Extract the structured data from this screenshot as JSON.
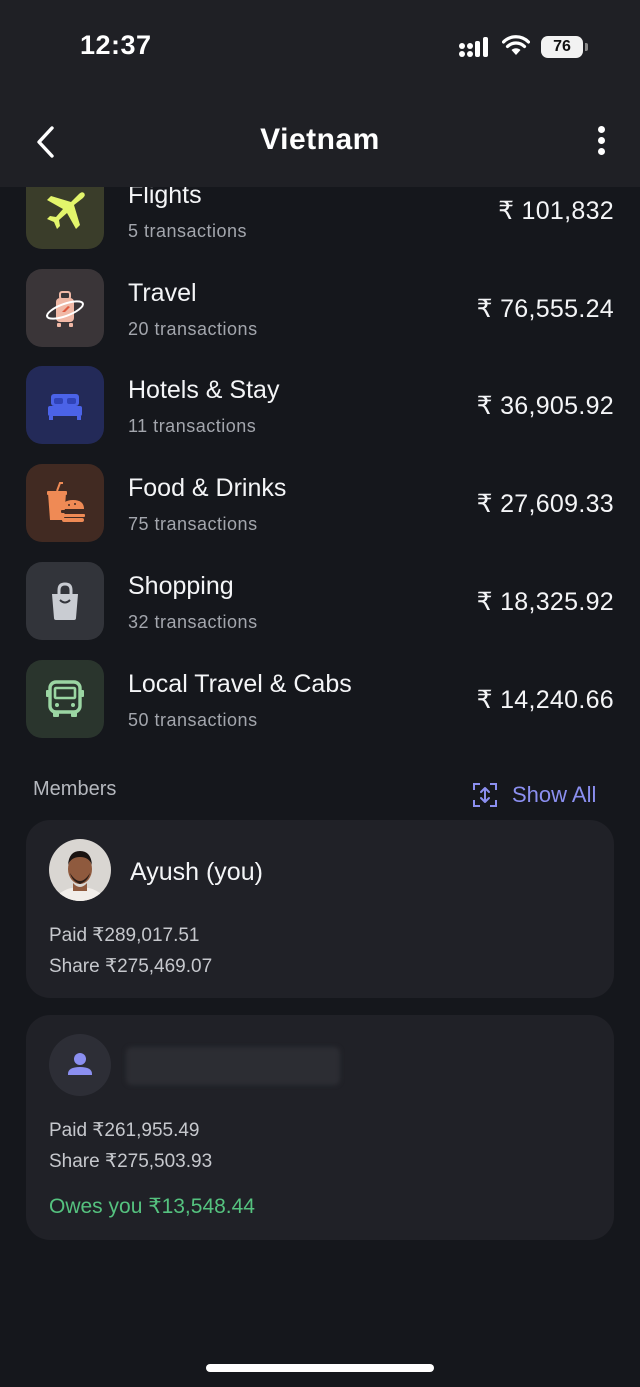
{
  "status_bar": {
    "time": "12:37",
    "battery": "76"
  },
  "header": {
    "title": "Vietnam"
  },
  "categories": [
    {
      "name": "Flights",
      "count": "5 transactions",
      "amount": "₹ 101,832",
      "icon": "airplane-icon",
      "bg": "#3a3d2a",
      "fg": "#e3f56b"
    },
    {
      "name": "Travel",
      "count": "20 transactions",
      "amount": "₹ 76,555.24",
      "icon": "luggage-icon",
      "bg": "#3a3538",
      "fg": "#f0b8a6"
    },
    {
      "name": "Hotels & Stay",
      "count": "11 transactions",
      "amount": "₹ 36,905.92",
      "icon": "bed-icon",
      "bg": "#232a58",
      "fg": "#4b63e8"
    },
    {
      "name": "Food & Drinks",
      "count": "75 transactions",
      "amount": "₹ 27,609.33",
      "icon": "burger-drink-icon",
      "bg": "#412a22",
      "fg": "#ef8a55"
    },
    {
      "name": "Shopping",
      "count": "32 transactions",
      "amount": "₹ 18,325.92",
      "icon": "shopping-bag-icon",
      "bg": "#32343a",
      "fg": "#c9ccd2"
    },
    {
      "name": "Local Travel & Cabs",
      "count": "50 transactions",
      "amount": "₹ 14,240.66",
      "icon": "bus-icon",
      "bg": "#2a352d",
      "fg": "#9bd6a3"
    }
  ],
  "members": {
    "label": "Members",
    "show_all": "Show All",
    "list": [
      {
        "name": "Ayush (you)",
        "paid": "Paid ₹289,017.51",
        "share": "Share ₹275,469.07"
      },
      {
        "name": "",
        "paid": "Paid ₹261,955.49",
        "share": "Share ₹275,503.93",
        "owes": "Owes you ₹13,548.44"
      }
    ]
  },
  "colors": {
    "accent": "#8b8ff0",
    "positive": "#55c27f",
    "background": "#15171c"
  }
}
